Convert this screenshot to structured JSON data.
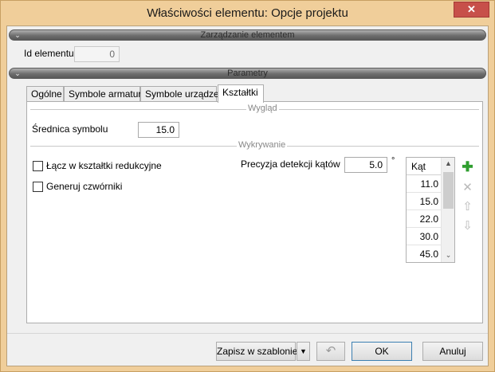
{
  "window": {
    "title": "Właściwości elementu: Opcje projektu",
    "close_glyph": "✕"
  },
  "sections": {
    "element_management": "Zarządzanie elementem",
    "parameters": "Parametry"
  },
  "element_id": {
    "label": "Id elementu",
    "value": "0"
  },
  "tabs": [
    {
      "label": "Ogólne",
      "active": false
    },
    {
      "label": "Symbole armatury",
      "active": false
    },
    {
      "label": "Symbole urządzeń",
      "active": false
    },
    {
      "label": "Kształtki",
      "active": true
    }
  ],
  "appearance": {
    "group_title": "Wygląd",
    "symbol_diameter_label": "Średnica symbolu",
    "symbol_diameter_value": "15.0"
  },
  "detection": {
    "group_title": "Wykrywanie",
    "reduction_checkbox_label": "Łącz w kształtki redukcyjne",
    "reduction_checked": false,
    "generate_crosses_label": "Generuj czwórniki",
    "generate_crosses_checked": false,
    "angle_precision_label": "Precyzja detekcji kątów",
    "angle_precision_value": "5.0",
    "angle_unit": "°"
  },
  "angles_grid": {
    "header": "Kąt",
    "rows": [
      "11.0",
      "15.0",
      "22.0",
      "30.0",
      "45.0"
    ]
  },
  "side_buttons": [
    {
      "icon": "add-icon",
      "glyph": "✚",
      "color": "#2f9e2f",
      "enabled": true
    },
    {
      "icon": "delete-icon",
      "glyph": "✕",
      "color": "#b9b9b9",
      "enabled": false
    },
    {
      "icon": "move-up-icon",
      "glyph": "⇧",
      "color": "#b9b9b9",
      "enabled": false
    },
    {
      "icon": "move-down-icon",
      "glyph": "⇩",
      "color": "#b9b9b9",
      "enabled": false
    }
  ],
  "footer": {
    "save_template_label": "Zapisz w szablonie",
    "dropdown_glyph": "▼",
    "undo_glyph": "↶",
    "ok_label": "OK",
    "cancel_label": "Anuluj"
  },
  "colors": {
    "frame": "#f0ce9a",
    "close_button": "#c7504a",
    "add_icon": "#2f9e2f"
  }
}
